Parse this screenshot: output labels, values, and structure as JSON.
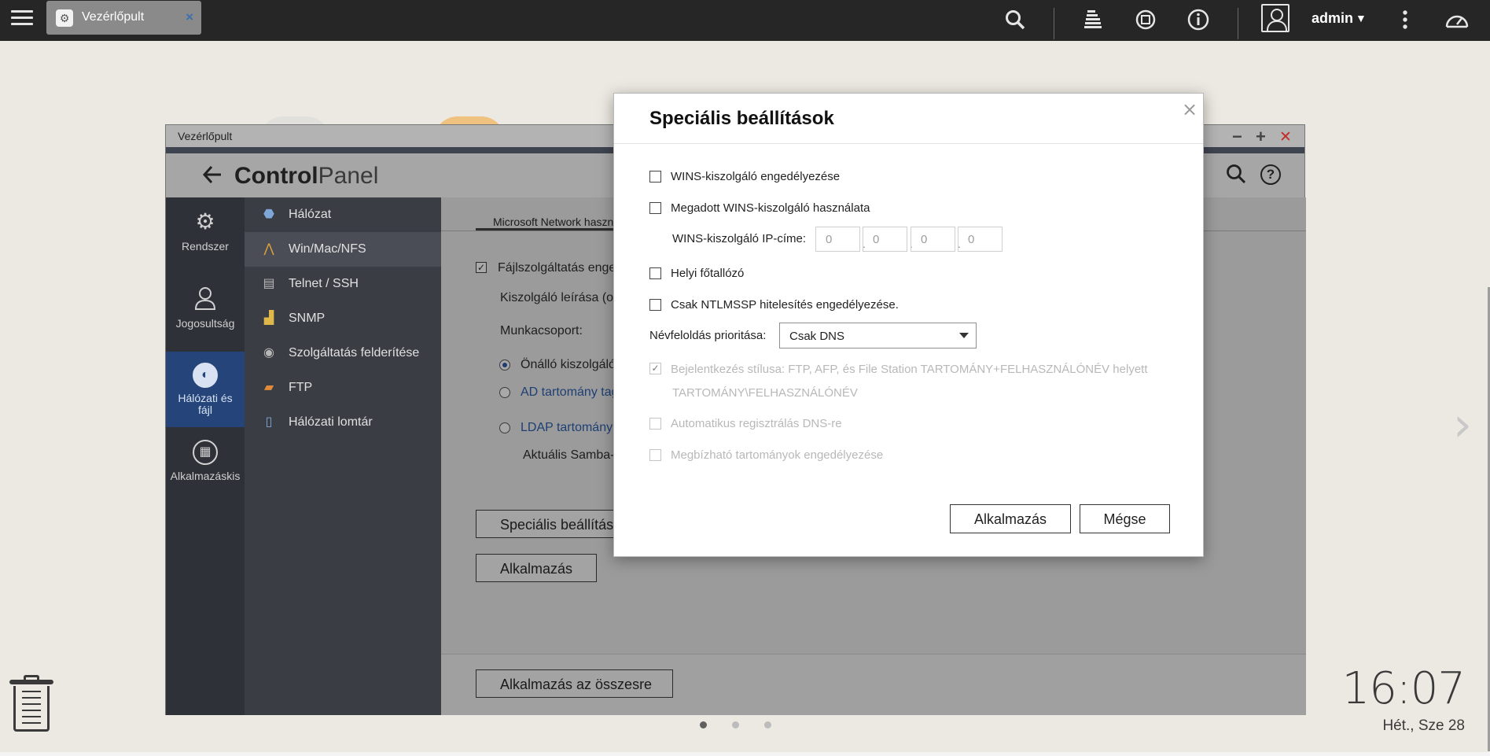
{
  "topbar": {
    "tab_label": "Vezérlőpult",
    "tab_close": "×",
    "user": "admin",
    "icons": [
      "menu-icon",
      "search-icon",
      "stack-icon",
      "sync-icon",
      "info-icon",
      "user-icon",
      "more-vertical-icon",
      "gauge-icon"
    ]
  },
  "window": {
    "title": "Vezérlőpult",
    "controls": {
      "minimize": "−",
      "maximize": "+",
      "close": "✕"
    },
    "header": {
      "title_bold": "Control",
      "title_thin": "Panel"
    }
  },
  "rail": [
    {
      "label": "Rendszer",
      "icon": "gear-icon"
    },
    {
      "label": "Jogosultság",
      "icon": "user-icon"
    },
    {
      "label": "Hálózati és fájl",
      "icon": "globe-icon",
      "active": true
    },
    {
      "label": "Alkalmazáskis",
      "icon": "apps-icon"
    }
  ],
  "submenu": [
    {
      "label": "Hálózat",
      "icon": "network-icon"
    },
    {
      "label": "Win/Mac/NFS",
      "icon": "win-mac-nfs-icon",
      "active": true
    },
    {
      "label": "Telnet / SSH",
      "icon": "terminal-icon"
    },
    {
      "label": "SNMP",
      "icon": "chart-icon"
    },
    {
      "label": "Szolgáltatás felderítése",
      "icon": "discovery-icon"
    },
    {
      "label": "FTP",
      "icon": "ftp-icon"
    },
    {
      "label": "Hálózati lomtár",
      "icon": "recycle-bin-icon"
    }
  ],
  "content": {
    "tab": "Microsoft Network haszn",
    "file_service": "Fájlszolgáltatás enged",
    "server_desc": "Kiszolgáló leírása (op",
    "workgroup": "Munkacsoport:",
    "radio_standalone": "Önálló kiszolgáló",
    "radio_ad": "AD tartomány tag",
    "radio_ldap": "LDAP tartomány h",
    "current_samba": "Aktuális Samba-a",
    "btn_advanced": "Speciális beállítás",
    "btn_apply": "Alkalmazás",
    "btn_apply_all": "Alkalmazás az összesre"
  },
  "modal": {
    "title": "Speciális beállítások",
    "close": "×",
    "wins_enable": "WINS-kiszolgáló engedélyezése",
    "wins_use": "Megadott WINS-kiszolgáló használata",
    "wins_ip_label": "WINS-kiszolgáló IP-címe:",
    "wins_ip": [
      "0",
      "0",
      "0",
      "0"
    ],
    "local_master": "Helyi főtallózó",
    "ntlmssp": "Csak NTLMSSP hitelesítés engedélyezése.",
    "name_resolution_label": "Névfeloldás prioritása:",
    "name_resolution_value": "Csak DNS",
    "login_style_line1": "Bejelentkezés stílusa: FTP, AFP, és File Station TARTOMÁNY+FELHASZNÁLÓNÉV helyett",
    "login_style_line2": "TARTOMÁNY\\FELHASZNÁLÓNÉV",
    "auto_dns": "Automatikus regisztrálás DNS-re",
    "trusted_domains": "Megbízható tartományok engedélyezése",
    "btn_apply": "Alkalmazás",
    "btn_cancel": "Mégse"
  },
  "desktop": {
    "clock_time": "16:07",
    "clock_date": "Hét., Sze 28"
  }
}
